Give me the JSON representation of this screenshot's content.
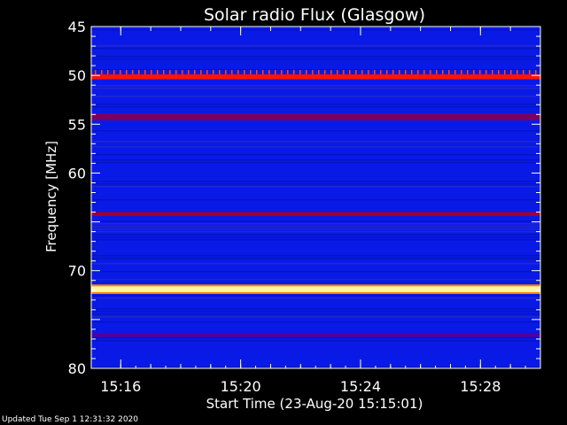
{
  "chart_data": {
    "type": "heatmap",
    "title": "Solar radio Flux (Glasgow)",
    "xlabel": "Start Time (23-Aug-20 15:15:01)",
    "ylabel": "Frequency [MHz]",
    "x_range": [
      "15:15:01",
      "15:30:00"
    ],
    "y_range": [
      45,
      80
    ],
    "y_inverted": true,
    "x_ticks": [
      "15:16",
      "15:20",
      "15:24",
      "15:28"
    ],
    "y_ticks": [
      "45",
      "50",
      "55",
      "60",
      "70",
      "80"
    ],
    "y_tick_values": [
      45,
      50,
      55,
      60,
      65,
      70,
      75,
      80
    ],
    "background_color": "#0a1ae6",
    "bands": [
      {
        "freq_start": 49.9,
        "freq_end": 50.4,
        "color": "#ff1500",
        "flicker": true
      },
      {
        "freq_start": 53.9,
        "freq_end": 54.6,
        "color": "#7a0060"
      },
      {
        "freq_start": 64.0,
        "freq_end": 64.4,
        "color": "#a00030"
      },
      {
        "freq_start": 71.6,
        "freq_end": 72.2,
        "color": "#fff6a0",
        "glow": "#ff8800"
      },
      {
        "freq_start": 76.4,
        "freq_end": 76.8,
        "color": "#5000a0"
      }
    ]
  },
  "footer": "Updated Tue Sep  1 12:31:32 2020"
}
